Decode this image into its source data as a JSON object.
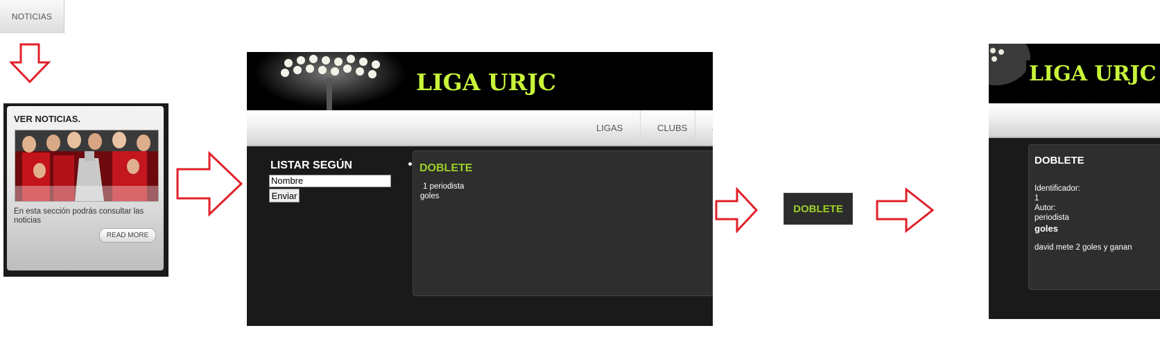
{
  "noticias_tab": {
    "label": "NOTICIAS"
  },
  "news_card": {
    "title": "VER NOTICIAS.",
    "description": "En esta sección podrás consultar las noticias",
    "read_more": "READ MORE"
  },
  "site": {
    "logo": "LIGA URJC",
    "nav": [
      "LIGAS",
      "CLUBS",
      "JU"
    ]
  },
  "list_page": {
    "list_heading": "LISTAR SEGÚN",
    "input_value": "Nombre",
    "submit_label": "Enviar",
    "news_title": "DOBLETE",
    "news_author_line": "1 periodista",
    "news_tag": "goles"
  },
  "badge": {
    "label": "DOBLETE"
  },
  "detail_page": {
    "title": "DOBLETE",
    "id_label": "Identificador:",
    "id_value": "1",
    "author_label": "Autor:",
    "author_value": "periodista",
    "tag": "goles",
    "body": "david mete 2 goles y ganan"
  },
  "colors": {
    "accent_green": "#9bd12a",
    "logo_green": "#c8f53a",
    "arrow_red": "#e0202a"
  },
  "icons": [
    "arrow-down-icon",
    "arrow-right-icon"
  ]
}
